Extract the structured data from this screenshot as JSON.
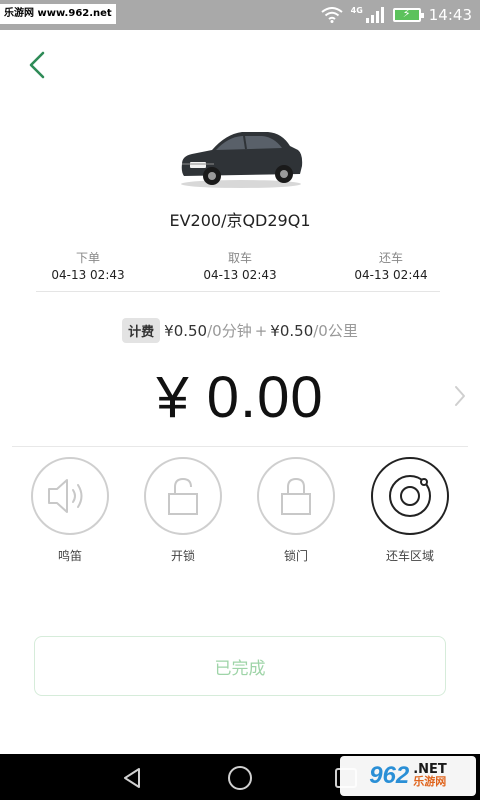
{
  "status_bar": {
    "watermark": "乐游网 www.962.net",
    "network_label": "4G",
    "time": "14:43",
    "wifi_icon": "wifi-icon",
    "signal_icon": "signal-icon",
    "battery_icon": "battery-charging-icon",
    "background_color": "#a9a9a9"
  },
  "header": {
    "back_icon": "chevron-left-icon",
    "accent_color": "#2e8b57"
  },
  "car": {
    "image_icon": "car-image",
    "title": "EV200/京QD29Q1"
  },
  "times": [
    {
      "label": "下单",
      "value": "04-13 02:43"
    },
    {
      "label": "取车",
      "value": "04-13 02:43"
    },
    {
      "label": "还车",
      "value": "04-13 02:44"
    }
  ],
  "pricing": {
    "badge": "计费",
    "time_price": "¥0.50",
    "time_unit": "/0分钟",
    "plus": "+",
    "distance_price": "¥0.50",
    "distance_unit": "/0公里"
  },
  "total": {
    "amount": "¥ 0.00",
    "arrow_icon": "chevron-right-icon"
  },
  "actions": [
    {
      "label": "鸣笛",
      "icon": "horn-icon",
      "active": false
    },
    {
      "label": "开锁",
      "icon": "unlock-icon",
      "active": false
    },
    {
      "label": "锁门",
      "icon": "lock-icon",
      "active": false
    },
    {
      "label": "还车区域",
      "icon": "return-area-icon",
      "active": true
    }
  ],
  "complete_button": {
    "label": "已完成",
    "text_color": "#9fd4a8"
  },
  "nav_bar": {
    "back_icon": "nav-back-icon",
    "home_icon": "nav-home-icon",
    "recent_icon": "nav-recent-icon"
  },
  "bottom_watermark": {
    "number": "962",
    "dot_net": ".NET",
    "cn_name": "乐游网"
  }
}
